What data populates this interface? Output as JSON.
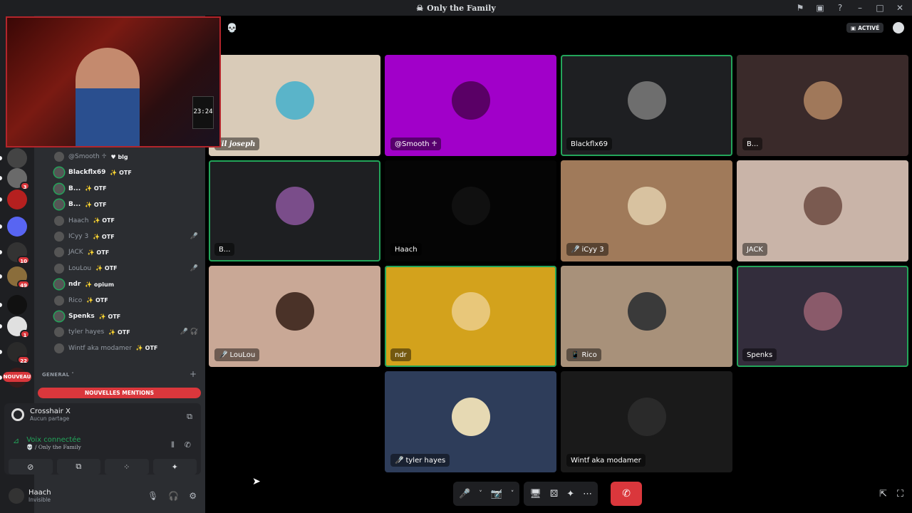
{
  "window": {
    "title": "Only the Family",
    "controls": [
      "flag",
      "inbox",
      "help",
      "minimize",
      "maximize",
      "close"
    ]
  },
  "server_rail": [
    {
      "name": "server-1",
      "color": "#444",
      "badge": ""
    },
    {
      "name": "server-2",
      "color": "#6a6a6a",
      "badge": "3"
    },
    {
      "name": "server-3",
      "color": "#b5201f",
      "badge": ""
    },
    {
      "name": "server-4",
      "color": "#5865f2",
      "badge": ""
    },
    {
      "name": "server-5",
      "color": "#333",
      "badge": "10"
    },
    {
      "name": "server-6",
      "color": "#8a6d3b",
      "badge": "49"
    },
    {
      "name": "server-7",
      "color": "#111",
      "badge": ""
    },
    {
      "name": "server-8",
      "color": "#e0e0e0",
      "badge": "1"
    },
    {
      "name": "server-9",
      "color": "#2a2a2a",
      "badge": "22"
    },
    {
      "name": "server-10",
      "color": "#3a1a1a",
      "badge": ""
    }
  ],
  "voice_channel_members": [
    {
      "name": "@Smooth ♱",
      "tag": "♥ blg",
      "active": false,
      "icons": ""
    },
    {
      "name": "Blackflx69",
      "tag": "✨ OTF",
      "active": true,
      "icons": ""
    },
    {
      "name": "B...",
      "tag": "✨ OTF",
      "active": true,
      "icons": ""
    },
    {
      "name": "B...",
      "tag": "✨ OTF",
      "active": true,
      "icons": ""
    },
    {
      "name": "Haach",
      "tag": "✨ OTF",
      "active": false,
      "icons": ""
    },
    {
      "name": "ICyy 3",
      "tag": "✨ OTF",
      "active": false,
      "icons": "🎤̸"
    },
    {
      "name": "JACK",
      "tag": "✨ OTF",
      "active": false,
      "icons": ""
    },
    {
      "name": "LouLou",
      "tag": "✨ OTF",
      "active": false,
      "icons": "🎤̸"
    },
    {
      "name": "ndr",
      "tag": "✨ opium",
      "active": true,
      "icons": ""
    },
    {
      "name": "Rico",
      "tag": "✨ OTF",
      "active": false,
      "icons": ""
    },
    {
      "name": "Spenks",
      "tag": "✨ OTF",
      "active": true,
      "icons": ""
    },
    {
      "name": "tyler hayes",
      "tag": "✨ OTF",
      "active": false,
      "icons": "🎤̸ 🎧̸"
    },
    {
      "name": "Wintf aka modamer",
      "tag": "✨ OTF",
      "active": false,
      "icons": ""
    }
  ],
  "category_label": "GENERAL",
  "nouveau_label": "NOUVEAU",
  "mentions_label": "NOUVELLES MENTIONS",
  "game": {
    "name": "Crosshair X",
    "status": "Aucun partage"
  },
  "voice": {
    "status": "Voix connectée",
    "channel": "💀 / Only the Family"
  },
  "user": {
    "name": "Haach",
    "status": "Invisible"
  },
  "cam_clock": "23:24",
  "active_badge": "ACTIVÉ",
  "tiles": [
    {
      "label": "lil joseph",
      "bg": "#d9cbb8",
      "av": "#5ab4c9",
      "speaking": false,
      "icon": ""
    },
    {
      "label": "@Smooth ♱",
      "bg": "#a100c9",
      "av": "#5a0066",
      "speaking": false,
      "icon": ""
    },
    {
      "label": "Blackflx69",
      "bg": "#1e1f22",
      "av": "#6e6e6e",
      "speaking": true,
      "icon": ""
    },
    {
      "label": "B...",
      "bg": "#3a2a2a",
      "av": "#a0785a",
      "speaking": false,
      "icon": ""
    },
    {
      "label": "B...",
      "bg": "#1e1f22",
      "av": "#7a4d8a",
      "speaking": true,
      "icon": ""
    },
    {
      "label": "Haach",
      "bg": "#050505",
      "av": "#101010",
      "speaking": false,
      "icon": ""
    },
    {
      "label": "iCyy 3",
      "bg": "#a07a5a",
      "av": "#d8c2a0",
      "speaking": false,
      "icon": "🎤̸"
    },
    {
      "label": "JACK",
      "bg": "#c9b4a8",
      "av": "#7a5a50",
      "speaking": false,
      "icon": ""
    },
    {
      "label": "LouLou",
      "bg": "#c9a896",
      "av": "#4a3228",
      "speaking": false,
      "icon": "🎤̸"
    },
    {
      "label": "ndr",
      "bg": "#d3a21c",
      "av": "#e8c77a",
      "speaking": true,
      "icon": ""
    },
    {
      "label": "Rico",
      "bg": "#a8917a",
      "av": "#3a3a3a",
      "speaking": false,
      "icon": "📱"
    },
    {
      "label": "Spenks",
      "bg": "#332d3c",
      "av": "#8a5a6a",
      "speaking": true,
      "icon": ""
    },
    {
      "label": "tyler hayes",
      "bg": "#2e3d5a",
      "av": "#e6d9b3",
      "speaking": false,
      "icon": "🎤̸"
    },
    {
      "label": "Wintf aka modamer",
      "bg": "#1a1a1a",
      "av": "#2a2a2a",
      "speaking": false,
      "icon": ""
    }
  ],
  "controls": {
    "mic": "🎤",
    "camera": "📷̸",
    "share": "🖥",
    "activity": "⚄",
    "soundboard": "✦",
    "more": "⋯",
    "hangup": "✆"
  }
}
